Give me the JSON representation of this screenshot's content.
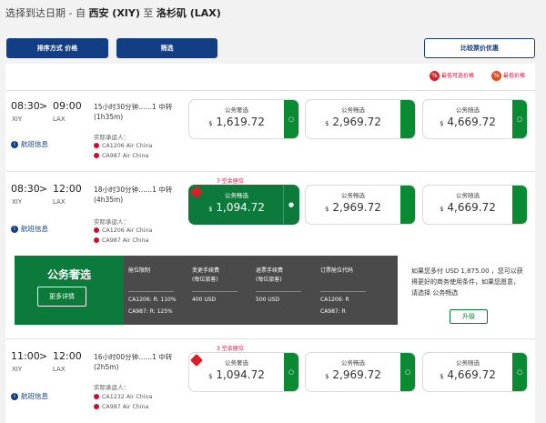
{
  "header": {
    "prefix": "选择到达日期 - 自",
    "origin": "西安 (XIY)",
    "to": "至",
    "destination": "洛杉矶 (LAX)"
  },
  "toolbar": {
    "sort_label": "排序方式 价格",
    "filter_label": "筛选",
    "compare_label": "比较票价优惠"
  },
  "legend": {
    "lowest_label": "最低可选价格",
    "lowest_icon": "tag-icon",
    "cheapest_label": "最低价格",
    "cheapest_icon": "tag-icon"
  },
  "flights": [
    {
      "dep_time": "08:30",
      "arr_time": "09:00",
      "dep_code": "XIY",
      "arr_code": "LAX",
      "duration_line": "15小时30分钟……1 中转",
      "duration": "(1h35m)",
      "carrier_label": "实际承运人：",
      "segments": [
        "CA1206 Air China",
        "CA987 Air China"
      ],
      "info_label": "航班信息",
      "seats_left": "",
      "fares": [
        {
          "name": "公务奢选",
          "currency": "$",
          "price": "1,619.72",
          "selected": false,
          "marker": "○"
        },
        {
          "name": "公务畅选",
          "currency": "$",
          "price": "2,969.72",
          "selected": false,
          "marker": ""
        },
        {
          "name": "公务随选",
          "currency": "$",
          "price": "4,669.72",
          "selected": false,
          "marker": "○"
        }
      ]
    },
    {
      "dep_time": "08:30",
      "arr_time": "12:00",
      "dep_code": "XIY",
      "arr_code": "LAX",
      "duration_line": "18小时30分钟……1 中转",
      "duration": "(4h35m)",
      "carrier_label": "实际承运人：",
      "segments": [
        "CA1206 Air China",
        "CA987 Air China"
      ],
      "info_label": "航班信息",
      "seats_left": "7 空余座位",
      "fares": [
        {
          "name": "公务畅选",
          "currency": "$",
          "price": "1,094.72",
          "selected": true,
          "marker": "●"
        },
        {
          "name": "公务畅选",
          "currency": "$",
          "price": "2,969.72",
          "selected": false,
          "marker": ""
        },
        {
          "name": "公务随选",
          "currency": "$",
          "price": "4,669.72",
          "selected": false,
          "marker": ""
        }
      ]
    },
    {
      "dep_time": "11:00",
      "arr_time": "12:00",
      "dep_code": "XIY",
      "arr_code": "LAX",
      "duration_line": "16小时00分钟……1 中转",
      "duration": "(2h5m)",
      "carrier_label": "实际承运人：",
      "segments": [
        "CA1232 Air China",
        "CA987 Air China"
      ],
      "info_label": "航班信息",
      "seats_left": "3 空余座位",
      "fares": [
        {
          "name": "公务奢选",
          "currency": "$",
          "price": "1,094.72",
          "selected": false,
          "marker": "○"
        },
        {
          "name": "公务畅选",
          "currency": "$",
          "price": "2,969.72",
          "selected": false,
          "marker": "○"
        },
        {
          "name": "公务随选",
          "currency": "$",
          "price": "4,669.72",
          "selected": false,
          "marker": "○"
        }
      ]
    }
  ],
  "promo": {
    "brand_name": "公务奢选",
    "more_label": "更多详情",
    "col1_header": "舱位限制",
    "col1_values": [
      "CA1206: R: 110%",
      "CA987: R: 125%"
    ],
    "col2_header": "变更手续费\n(每位旅客)",
    "col2_value": "400 USD",
    "col3_header": "退票手续费\n(每位旅客)",
    "col3_value": "500 USD",
    "col4_header": "订票舱位代码",
    "col4_values": [
      "CA1206: R",
      "CA987: R"
    ],
    "upsell_text": "如果您多付 USD 1,875.00 ，您可以获得更好的商务使用条件，如果您愿意，请选择 公务畅选",
    "upgrade_label": "升级"
  },
  "colors": {
    "navy": "#123e84",
    "green": "#0b7a3a",
    "red": "#c8102e",
    "dark": "#4a4a4a"
  }
}
